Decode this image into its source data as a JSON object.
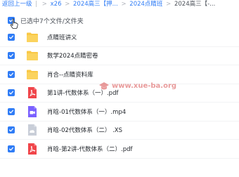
{
  "breadcrumb": {
    "back": "返回上一级",
    "items": [
      "x26",
      "2024高三【押...",
      "2024点睛班",
      "2024高三【-..."
    ],
    "separator": ">",
    "divider": "|"
  },
  "selection": {
    "text": "已选中7个文件/文件夹"
  },
  "files": [
    {
      "name": "点睛班讲义",
      "type": "folder"
    },
    {
      "name": "数学2024点睛密卷",
      "type": "folder"
    },
    {
      "name": "肖合--点睛资料库",
      "type": "folder"
    },
    {
      "name": "第1讲-代数体系（一）.pdf",
      "type": "pdf"
    },
    {
      "name": "肖晗-01代数体系（一）.mp4",
      "type": "video"
    },
    {
      "name": "肖晗-02代数体系（二） .XS",
      "type": "cloud"
    },
    {
      "name": "肖晗-第2讲-代数体系（二）.pdf",
      "type": "pdf"
    }
  ],
  "watermark": {
    "text": "www.xue-ba.org"
  },
  "colors": {
    "accent": "#2f7cf6",
    "folder": "#f9c846",
    "pdf": "#f0454a",
    "video": "#7b61ff",
    "cloud": "#c9ced8"
  }
}
